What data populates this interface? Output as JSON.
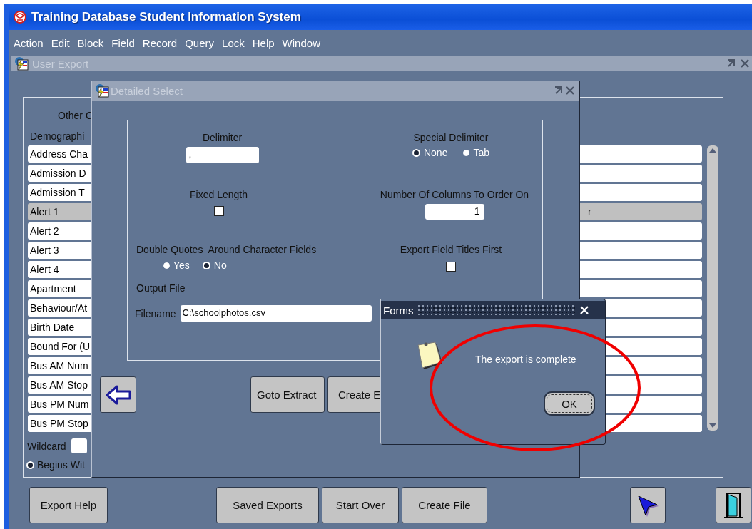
{
  "window": {
    "title": "Training Database Student Information System"
  },
  "menu": [
    "Action",
    "Edit",
    "Block",
    "Field",
    "Record",
    "Query",
    "Lock",
    "Help",
    "Window"
  ],
  "user_export": {
    "title": "User Export",
    "other_label": "Other C",
    "list_heading": "Demographi",
    "rows": [
      {
        "label": "Address Cha",
        "selected": false
      },
      {
        "label": "Admission D",
        "selected": false
      },
      {
        "label": "Admission T",
        "selected": false
      },
      {
        "label": "Alert 1",
        "tail": "r",
        "selected": true
      },
      {
        "label": "Alert 2",
        "selected": false
      },
      {
        "label": "Alert 3",
        "selected": false
      },
      {
        "label": "Alert 4",
        "selected": false
      },
      {
        "label": "Apartment",
        "selected": false
      },
      {
        "label": "Behaviour/At",
        "selected": false
      },
      {
        "label": "Birth Date",
        "selected": false
      },
      {
        "label": "Bound For (U",
        "selected": false
      },
      {
        "label": "Bus AM Num",
        "selected": false
      },
      {
        "label": "Bus AM Stop",
        "selected": false
      },
      {
        "label": "Bus PM Num",
        "selected": false
      },
      {
        "label": "Bus PM Stop",
        "selected": false
      }
    ],
    "wildcard": {
      "label": "Wildcard"
    },
    "match_options": [
      {
        "label": "Begins Wit",
        "selected": true
      }
    ],
    "buttons": [
      "Export Help",
      "Saved Exports",
      "Start Over",
      "Create File"
    ]
  },
  "detailed_select": {
    "title": "Detailed Select",
    "delimiter": {
      "label": "Delimiter",
      "value": ","
    },
    "special_delimiter": {
      "label": "Special Delimiter",
      "options": [
        {
          "label": "None",
          "selected": true
        },
        {
          "label": "Tab",
          "selected": false
        }
      ]
    },
    "fixed_length": {
      "label": "Fixed Length",
      "checked": false
    },
    "order_columns": {
      "label": "Number Of Columns To Order On",
      "value": "1"
    },
    "double_quotes": {
      "label": "Double Quotes  Around Character Fields",
      "options": [
        {
          "label": "Yes",
          "selected": false
        },
        {
          "label": "No",
          "selected": true
        }
      ]
    },
    "titles_first": {
      "label": "Export Field Titles First",
      "checked": false
    },
    "output_label": "Output File",
    "filename": {
      "label": "Filename",
      "value": "C:\\schoolphotos.csv"
    },
    "buttons": [
      "Goto Extract",
      "Create E"
    ]
  },
  "alert": {
    "title": "Forms",
    "message": "The export is complete",
    "button": "OK"
  }
}
